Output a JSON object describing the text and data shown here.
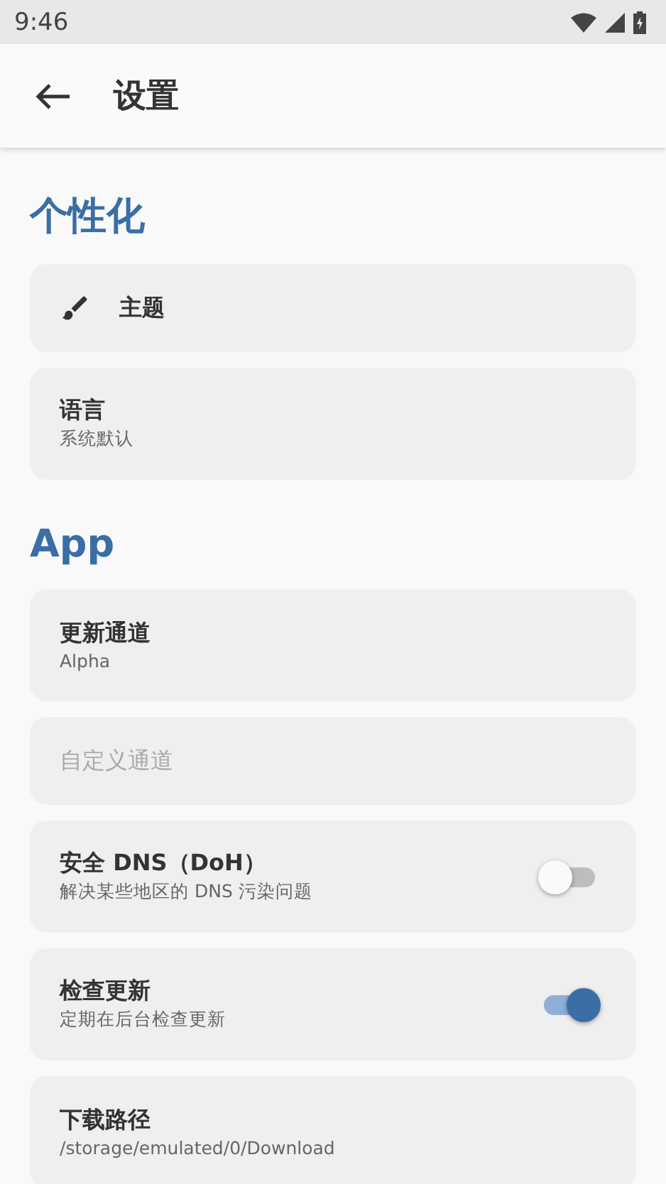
{
  "status_bar": {
    "time": "9:46"
  },
  "app_bar": {
    "title": "设置"
  },
  "sections": [
    {
      "title": "个性化",
      "items": [
        {
          "kind": "icon",
          "title": "主题",
          "disabled": false
        },
        {
          "kind": "text",
          "title": "语言",
          "subtitle": "系统默认",
          "disabled": false
        }
      ]
    },
    {
      "title": "App",
      "items": [
        {
          "kind": "text",
          "title": "更新通道",
          "subtitle": "Alpha",
          "disabled": false
        },
        {
          "kind": "text",
          "title": "自定义通道",
          "disabled": true
        },
        {
          "kind": "switch",
          "title": "安全 DNS（DoH）",
          "subtitle": "解决某些地区的 DNS 污染问题",
          "on": false,
          "disabled": false
        },
        {
          "kind": "switch",
          "title": "检查更新",
          "subtitle": "定期在后台检查更新",
          "on": true,
          "disabled": false
        },
        {
          "kind": "text",
          "title": "下载路径",
          "subtitle": "/storage/emulated/0/Download",
          "disabled": false
        }
      ]
    }
  ]
}
